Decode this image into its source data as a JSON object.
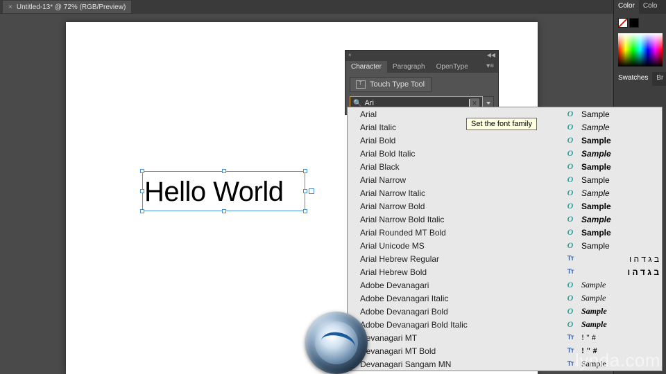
{
  "tab": {
    "title": "Untitled-13* @ 72% (RGB/Preview)"
  },
  "canvas": {
    "text": "Hello World"
  },
  "char_panel": {
    "tabs": {
      "character": "Character",
      "paragraph": "Paragraph",
      "opentype": "OpenType"
    },
    "touch_type": "Touch Type Tool",
    "font_query": "Ari"
  },
  "tooltip": {
    "text": "Set the font family"
  },
  "font_list": [
    {
      "name": "Arial",
      "type": "o",
      "sample": "Sample",
      "style": "font-family:Arial;"
    },
    {
      "name": "Arial Italic",
      "type": "o",
      "sample": "Sample",
      "style": "font-family:Arial;font-style:italic;"
    },
    {
      "name": "Arial Bold",
      "type": "o",
      "sample": "Sample",
      "style": "font-family:Arial;font-weight:bold;"
    },
    {
      "name": "Arial Bold Italic",
      "type": "o",
      "sample": "Sample",
      "style": "font-family:Arial;font-weight:bold;font-style:italic;"
    },
    {
      "name": "Arial Black",
      "type": "o",
      "sample": "Sample",
      "style": "font-family:'Arial Black',Arial;font-weight:900;"
    },
    {
      "name": "Arial Narrow",
      "type": "o",
      "sample": "Sample",
      "style": "font-family:'Arial Narrow',Arial;font-stretch:condensed;"
    },
    {
      "name": "Arial Narrow Italic",
      "type": "o",
      "sample": "Sample",
      "style": "font-family:'Arial Narrow',Arial;font-style:italic;font-stretch:condensed;"
    },
    {
      "name": "Arial Narrow Bold",
      "type": "o",
      "sample": "Sample",
      "style": "font-family:'Arial Narrow',Arial;font-weight:bold;font-stretch:condensed;"
    },
    {
      "name": "Arial Narrow Bold Italic",
      "type": "o",
      "sample": "Sample",
      "style": "font-family:'Arial Narrow',Arial;font-weight:bold;font-style:italic;font-stretch:condensed;"
    },
    {
      "name": "Arial Rounded MT Bold",
      "type": "o",
      "sample": "Sample",
      "style": "font-family:Arial;font-weight:bold;"
    },
    {
      "name": "Arial Unicode MS",
      "type": "o",
      "sample": "Sample",
      "style": "font-family:Arial;"
    },
    {
      "name": "Arial Hebrew Regular",
      "type": "tt",
      "sample": "ב ג ד ה ו",
      "style": "font-family:Arial;direction:rtl;"
    },
    {
      "name": "Arial Hebrew Bold",
      "type": "tt",
      "sample": "ב ג ד ה ו",
      "style": "font-family:Arial;font-weight:bold;direction:rtl;"
    },
    {
      "name": "Adobe Devanagari",
      "type": "o",
      "sample": "Sample",
      "style": "font-family:serif;font-style:italic;"
    },
    {
      "name": "Adobe Devanagari Italic",
      "type": "o",
      "sample": "Sample",
      "style": "font-family:serif;font-style:italic;"
    },
    {
      "name": "Adobe Devanagari Bold",
      "type": "o",
      "sample": "Sample",
      "style": "font-family:serif;font-weight:bold;font-style:italic;"
    },
    {
      "name": "Adobe Devanagari Bold Italic",
      "type": "o",
      "sample": "Sample",
      "style": "font-family:serif;font-weight:bold;font-style:italic;"
    },
    {
      "name": "Devanagari MT",
      "type": "tt",
      "sample": "! \" #",
      "style": "font-family:serif;"
    },
    {
      "name": "Devanagari MT Bold",
      "type": "tt",
      "sample": "! \" #",
      "style": "font-family:serif;font-weight:bold;"
    },
    {
      "name": "Devanagari Sangam MN",
      "type": "tt",
      "sample": "Sample",
      "style": "font-family:serif;"
    }
  ],
  "right_panel": {
    "tabs": {
      "color": "Color",
      "color_guide": "Colo"
    },
    "section2": {
      "swatches": "Swatches",
      "brushes": "Br"
    }
  },
  "watermark": "lynda.com"
}
